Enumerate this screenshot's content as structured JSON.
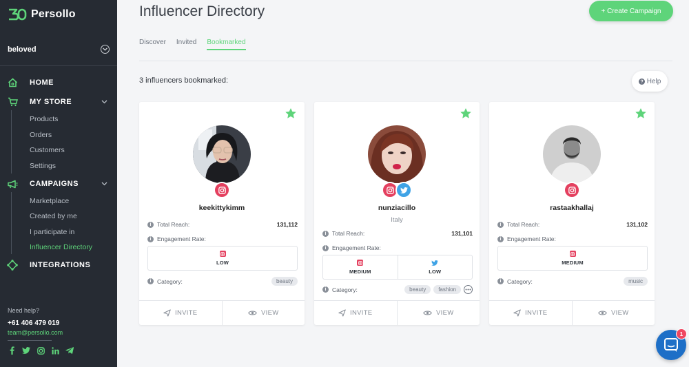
{
  "brand": {
    "name": "Persollo",
    "accent": "#5ed47a",
    "sidebar_bg": "#262b33"
  },
  "store": {
    "name": "beloved"
  },
  "nav": {
    "home": "HOME",
    "my_store": "MY STORE",
    "store_items": [
      "Products",
      "Orders",
      "Customers",
      "Settings"
    ],
    "campaigns": "CAMPAIGNS",
    "campaign_items": [
      "Marketplace",
      "Created by me",
      "I participate in",
      "Influencer Directory"
    ],
    "active_item": "Influencer Directory",
    "integrations": "INTEGRATIONS"
  },
  "help": {
    "title": "Need help?",
    "phone": "+61 406 479 019",
    "email": "team@persollo.com"
  },
  "social_icons": [
    "facebook-icon",
    "twitter-icon",
    "instagram-icon",
    "linkedin-icon",
    "telegram-icon"
  ],
  "header": {
    "title": "Influencer Directory",
    "create_button": "+ Create Campaign"
  },
  "tabs": [
    {
      "label": "Discover",
      "active": false
    },
    {
      "label": "Invited",
      "active": false
    },
    {
      "label": "Bookmarked",
      "active": true
    }
  ],
  "count_text": "3 influencers bookmarked:",
  "help_button": "Help",
  "labels": {
    "total_reach": "Total Reach:",
    "engagement_rate": "Engagement Rate:",
    "category": "Category:",
    "invite": "INVITE",
    "view": "VIEW"
  },
  "influencers": [
    {
      "username": "keekittykimm",
      "location": "",
      "networks": [
        "instagram"
      ],
      "total_reach": "131,112",
      "engagement": [
        {
          "network": "instagram",
          "level": "LOW"
        }
      ],
      "categories": [
        "beauty"
      ],
      "bookmarked": true
    },
    {
      "username": "nunziacillo",
      "location": "Italy",
      "networks": [
        "instagram",
        "twitter"
      ],
      "total_reach": "131,101",
      "engagement": [
        {
          "network": "instagram",
          "level": "MEDIUM"
        },
        {
          "network": "twitter",
          "level": "LOW"
        }
      ],
      "categories": [
        "beauty",
        "fashion"
      ],
      "bookmarked": true
    },
    {
      "username": "rastaakhallaj",
      "location": "",
      "networks": [
        "instagram"
      ],
      "total_reach": "131,102",
      "engagement": [
        {
          "network": "instagram",
          "level": "MEDIUM"
        }
      ],
      "categories": [
        "music"
      ],
      "bookmarked": true
    }
  ],
  "chat": {
    "unread": "1"
  }
}
